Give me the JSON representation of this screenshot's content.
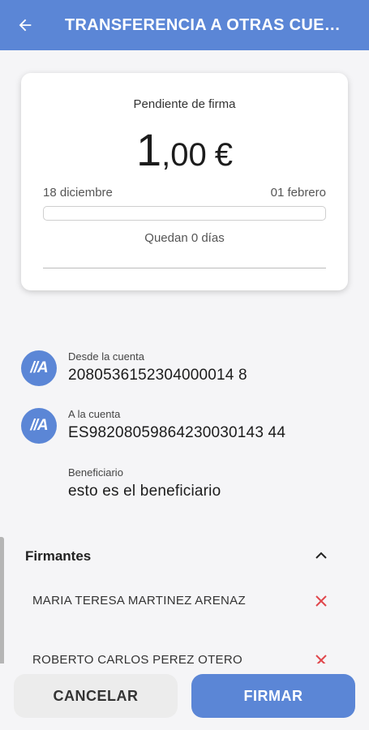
{
  "header": {
    "title": "TRANSFERENCIA A OTRAS CUENTAS"
  },
  "summary": {
    "status": "Pendiente de firma",
    "amount_int": "1",
    "amount_dec": ",00",
    "currency": "€",
    "start_date": "18 diciembre",
    "end_date": "01 febrero",
    "progress": 0,
    "remaining": "Quedan 0 días"
  },
  "from_account": {
    "icon_text": "//A",
    "label": "Desde la cuenta",
    "value": "2080536152304000014 8"
  },
  "to_account": {
    "icon_text": "//A",
    "label": "A la cuenta",
    "value": "ES98208059864230030143 44"
  },
  "beneficiary": {
    "label": "Beneficiario",
    "value": "esto es el beneficiario"
  },
  "signers": {
    "title": "Firmantes",
    "items": [
      {
        "name": "MARIA TERESA MARTINEZ ARENAZ"
      },
      {
        "name": "ROBERTO CARLOS PEREZ OTERO"
      }
    ]
  },
  "actions": {
    "cancel_label": "CANCELAR",
    "sign_label": "FIRMAR"
  },
  "colors": {
    "primary": "#5b86d6",
    "danger": "#e0474c"
  }
}
